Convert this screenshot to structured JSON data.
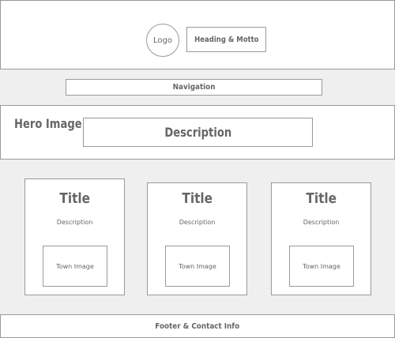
{
  "header": {
    "logo": "Logo",
    "heading": "Heading & Motto"
  },
  "nav": {
    "label": "Navigation"
  },
  "hero": {
    "image_label": "Hero Image",
    "description": "Description"
  },
  "cards": [
    {
      "title": "Title",
      "description": "Description",
      "image": "Town Image"
    },
    {
      "title": "Title",
      "description": "Description",
      "image": "Town Image"
    },
    {
      "title": "Title",
      "description": "Description",
      "image": "Town Image"
    }
  ],
  "footer": {
    "label": "Footer & Contact Info"
  }
}
